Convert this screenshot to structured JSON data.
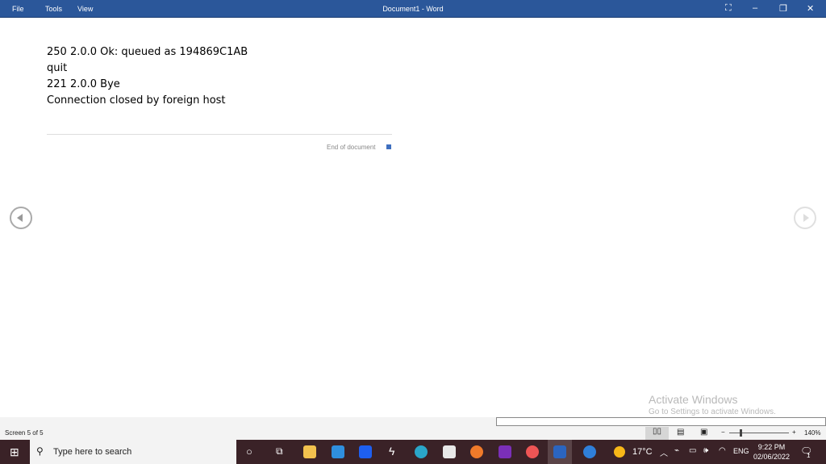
{
  "titlebar": {
    "menu": [
      "File",
      "Tools",
      "View"
    ],
    "title": "Document1 - Word"
  },
  "document": {
    "lines": [
      "250 2.0.0 Ok: queued as 194869C1AB",
      "quit",
      "221 2.0.0 Bye",
      "Connection closed by foreign host"
    ],
    "end_label": "End of document"
  },
  "watermark": {
    "title": "Activate Windows",
    "subtitle": "Go to Settings to activate Windows."
  },
  "status": {
    "screen": "Screen 5 of 5",
    "zoom": "140%",
    "zoom_minus": "−",
    "zoom_plus": "+"
  },
  "taskbar": {
    "search_placeholder": "Type here to search",
    "weather": "17°C",
    "language": "ENG",
    "time": "9:22 PM",
    "date": "02/06/2022",
    "notifications": "1"
  }
}
